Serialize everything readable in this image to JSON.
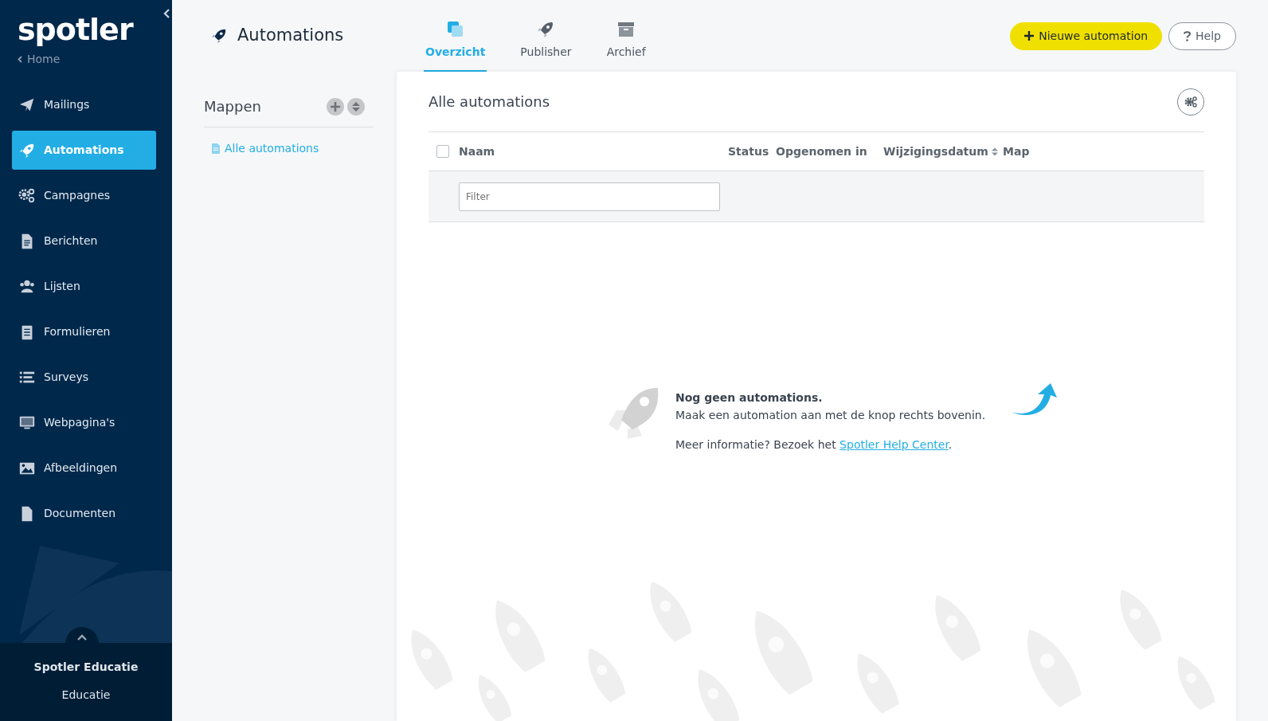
{
  "brand": {
    "logo": "spotler",
    "home_link": "Home"
  },
  "sidebar": {
    "items": [
      {
        "label": "Mailings",
        "selected": false
      },
      {
        "label": "Automations",
        "selected": true
      },
      {
        "label": "Campagnes",
        "selected": false
      },
      {
        "label": "Berichten",
        "selected": false
      },
      {
        "label": "Lijsten",
        "selected": false
      },
      {
        "label": "Formulieren",
        "selected": false
      },
      {
        "label": "Surveys",
        "selected": false
      },
      {
        "label": "Webpagina's",
        "selected": false
      },
      {
        "label": "Afbeeldingen",
        "selected": false
      },
      {
        "label": "Documenten",
        "selected": false
      }
    ],
    "account": {
      "name": "Spotler Educatie",
      "sub": "Educatie"
    }
  },
  "header": {
    "title": "Automations",
    "tabs": [
      {
        "label": "Overzicht",
        "selected": true
      },
      {
        "label": "Publisher",
        "selected": false
      },
      {
        "label": "Archief",
        "selected": false
      }
    ],
    "buttons": {
      "new": "Nieuwe automation",
      "help": "Help"
    }
  },
  "folders": {
    "title": "Mappen",
    "items": [
      {
        "label": "Alle automations",
        "selected": true
      }
    ]
  },
  "main": {
    "title": "Alle automations",
    "table": {
      "select_all_checked": false,
      "columns": [
        {
          "label": "Naam",
          "sortable": false
        },
        {
          "label": "Status",
          "sortable": false
        },
        {
          "label": "Opgenomen in",
          "sortable": false
        },
        {
          "label": "Wijzigingsdatum",
          "sortable": true
        },
        {
          "label": "Map",
          "sortable": false
        }
      ],
      "filter": {
        "placeholder": "Filter"
      }
    },
    "empty": {
      "heading": "Nog geen automations.",
      "text": "Maak een automation aan met de knop rechts bovenin.",
      "more": "Meer informatie? Bezoek het ",
      "link": "Spotler Help Center",
      "after": "."
    }
  }
}
